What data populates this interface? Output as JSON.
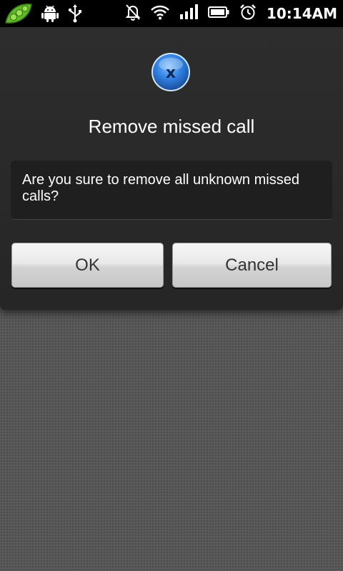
{
  "status_bar": {
    "time": "10:14AM",
    "left_icons": [
      "peapod-app-icon",
      "android-debug-icon",
      "usb-icon"
    ],
    "right_icons": [
      "notifications-muted-icon",
      "wifi-icon",
      "signal-icon",
      "battery-icon",
      "alarm-icon"
    ]
  },
  "dialog": {
    "icon": "close-x-icon",
    "title": "Remove missed call",
    "message": "Are you sure to remove all unknown missed calls?",
    "ok_label": "OK",
    "cancel_label": "Cancel"
  },
  "colors": {
    "dialog_bg": "#2a2a2a",
    "message_bg": "#1f1f1f",
    "icon_blue": "#2f7fe0",
    "background": "#5a5a5a"
  }
}
